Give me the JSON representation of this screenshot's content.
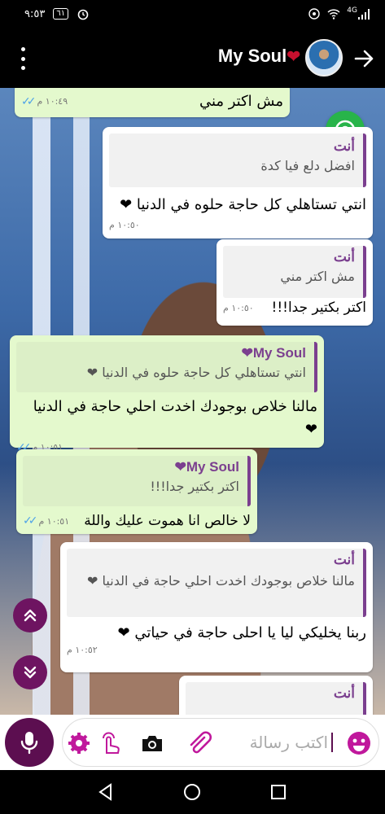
{
  "status_bar": {
    "time": "٩:٥٣",
    "battery": "٦١",
    "network": "4G"
  },
  "header": {
    "contact_name": "My Soul",
    "name_emoji": "❤"
  },
  "messages": [
    {
      "id": "m1",
      "direction": "incoming",
      "text": "مش اكتر مني",
      "time": "١٠:٤٩ م",
      "read": true
    },
    {
      "id": "m2",
      "direction": "outgoing",
      "quote_author": "أنت",
      "quote_text": "افضل دلع فيا كدة",
      "text": "انتي تستاهلي كل حاجة حلوه في الدنيا ❤",
      "time": "١٠:٥٠ م"
    },
    {
      "id": "m3",
      "direction": "outgoing",
      "quote_author": "أنت",
      "quote_text": "مش اكتر مني",
      "text": "اكتر بكتير جدا!!!",
      "time": "١٠:٥٠ م"
    },
    {
      "id": "m4",
      "direction": "incoming",
      "quote_author": "My Soul❤",
      "quote_text": "انتي تستاهلي كل حاجة حلوه في الدنيا ❤",
      "text": "مالنا خلاص بوجودك  اخدت احلي حاجة في الدنيا ❤",
      "time": "١٠:٥١ م",
      "read": true
    },
    {
      "id": "m5",
      "direction": "incoming",
      "quote_author": "My Soul❤",
      "quote_text": "اكتر بكتير جدا!!!",
      "text": "لا خالص انا هموت عليك واللة",
      "time": "١٠:٥١ م",
      "read": true
    },
    {
      "id": "m6",
      "direction": "outgoing",
      "quote_author": "أنت",
      "quote_text": "مالنا خلاص بوجودك  اخدت احلي حاجة في الدنيا ❤",
      "text": "ربنا يخليكي ليا يا احلى حاجة في حياتي ❤",
      "time": "١٠:٥٢ م"
    },
    {
      "id": "m7",
      "direction": "outgoing",
      "quote_author": "أنت",
      "quote_text": "",
      "text": "",
      "time": ""
    }
  ],
  "input": {
    "placeholder": "اكتب رسالة"
  },
  "colors": {
    "accent": "#5c0e50",
    "incoming_bubble": "#e4f9cd",
    "outgoing_bubble": "#ffffff",
    "quote_bar": "#7b3f8f",
    "float_button": "#28b44a",
    "read_ticks": "#4fa3e8"
  },
  "icons": {
    "status": [
      "alarm-icon",
      "battery-icon",
      "wifi-icon",
      "signal-icon",
      "vpn-icon"
    ],
    "header": [
      "menu-icon",
      "avatar",
      "back-arrow-icon"
    ],
    "input_bar": [
      "mic-icon",
      "settings-icon",
      "touch-icon",
      "camera-icon",
      "attach-icon",
      "emoji-icon"
    ],
    "navigation": [
      "nav-back-icon",
      "nav-home-icon",
      "nav-recents-icon"
    ]
  }
}
